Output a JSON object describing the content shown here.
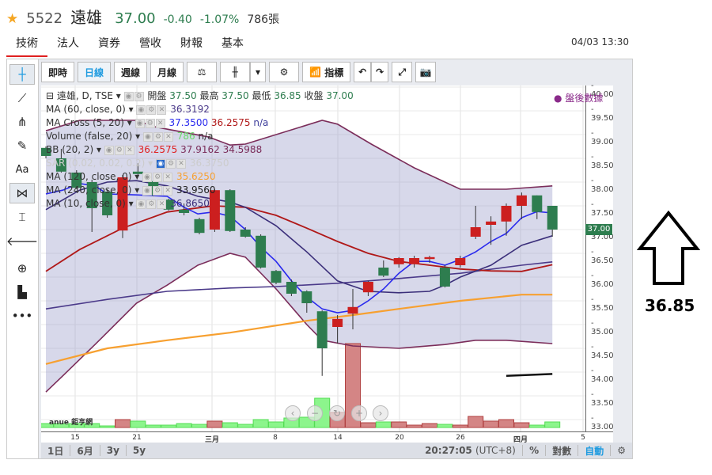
{
  "header": {
    "code": "5522",
    "name": "遠雄",
    "price": "37.00",
    "change": "-0.40",
    "change_pct": "-1.07%",
    "volume": "786張"
  },
  "tabs": [
    "技術",
    "法人",
    "資券",
    "營收",
    "財報",
    "基本"
  ],
  "datetime": "04/03 13:30",
  "toolbar": {
    "realtime": "即時",
    "daily": "日線",
    "weekly": "週線",
    "monthly": "月線",
    "indicators": "指標"
  },
  "legend": {
    "title": "遠雄, D, TSE",
    "open_label": "開盤",
    "open": "37.50",
    "high_label": "最高",
    "high": "37.50",
    "low_label": "最低",
    "low": "36.85",
    "close_label": "收盤",
    "close": "37.00",
    "ma60": "MA (60, close, 0)",
    "ma60_val": "36.3192",
    "macross": "MA Cross (5, 20)",
    "macross_v1": "37.3500",
    "macross_v2": "36.2575",
    "macross_v3": "n/a",
    "volume": "Volume (false, 20)",
    "volume_v1": "786",
    "volume_v2": "n/a",
    "bb": "BB (20, 2)",
    "bb_v1": "36.2575",
    "bb_v2": "37.9162",
    "bb_v3": "34.5988",
    "sar": "SAR (0.02, 0.02, 0.2)",
    "sar_val": "36.3750",
    "ma120": "MA (120, close, 0)",
    "ma120_val": "35.6250",
    "ma240": "MA (240, close, 0)",
    "ma240_val": "33.9560",
    "ma10": "MA (10, close, 0)",
    "ma10_val": "36.8650",
    "after_hours": "盤後數據"
  },
  "price_axis": [
    "40.00",
    "39.50",
    "39.00",
    "38.50",
    "38.00",
    "37.50",
    "37.00",
    "36.50",
    "36.00",
    "35.50",
    "35.00",
    "34.50",
    "34.00",
    "33.50",
    "33.00"
  ],
  "current_price_tag": "37.00",
  "x_axis": [
    "15",
    "21",
    "三月",
    "8",
    "14",
    "20",
    "26",
    "四月",
    "5"
  ],
  "logo": "anue 鉅亨網",
  "bottom": {
    "ranges": [
      "1日",
      "6月",
      "3y",
      "5y"
    ],
    "clock": "20:27:05",
    "tz": "(UTC+8)",
    "pct": "%",
    "log": "對數",
    "auto": "自動"
  },
  "annotation": {
    "value": "36.85"
  },
  "colors": {
    "up": "#cc1f1f",
    "down": "#2e7d4f",
    "ma5": "#2a2aee",
    "ma10": "#3b2f7a",
    "ma20": "#b01818",
    "ma60": "#4b3a8a",
    "ma120": "#f7a030",
    "bb": "#7b2d5a",
    "accent": "#1e9be0"
  },
  "chart_data": {
    "type": "candlestick",
    "ylim": [
      33,
      40
    ],
    "candles": [
      [
        38.72,
        38.75,
        38.5,
        38.55
      ],
      [
        38.5,
        38.7,
        38.2,
        38.22
      ],
      [
        38.2,
        38.25,
        37.85,
        37.88
      ],
      [
        38.0,
        38.05,
        36.95,
        37.45
      ],
      [
        37.8,
        37.85,
        37.25,
        37.3
      ],
      [
        36.98,
        38.15,
        36.82,
        38.1
      ],
      [
        38.22,
        38.4,
        38.15,
        38.17
      ],
      [
        38.02,
        38.05,
        37.7,
        37.72
      ],
      [
        37.63,
        37.65,
        37.4,
        37.42
      ],
      [
        37.42,
        37.55,
        37.3,
        37.35
      ],
      [
        37.22,
        37.25,
        36.9,
        36.93
      ],
      [
        37.0,
        37.85,
        36.95,
        37.83
      ],
      [
        37.83,
        37.85,
        36.95,
        36.97
      ],
      [
        37.0,
        37.05,
        36.83,
        36.85
      ],
      [
        36.87,
        36.9,
        36.18,
        36.2
      ],
      [
        36.13,
        36.15,
        35.85,
        35.88
      ],
      [
        35.9,
        35.95,
        35.6,
        35.65
      ],
      [
        35.7,
        35.72,
        35.25,
        35.45
      ],
      [
        35.28,
        35.3,
        33.92,
        34.5
      ],
      [
        34.95,
        35.2,
        34.6,
        35.12
      ],
      [
        35.23,
        35.75,
        34.9,
        35.37
      ],
      [
        35.68,
        35.92,
        35.6,
        35.9
      ],
      [
        36.2,
        36.35,
        36.0,
        36.03
      ],
      [
        36.27,
        36.42,
        36.2,
        36.4
      ],
      [
        36.27,
        36.45,
        36.2,
        36.4
      ],
      [
        36.38,
        36.45,
        36.3,
        36.42
      ],
      [
        36.2,
        36.25,
        35.78,
        35.8
      ],
      [
        36.25,
        36.45,
        36.2,
        36.4
      ],
      [
        36.85,
        37.5,
        36.8,
        37.05
      ],
      [
        37.1,
        37.28,
        36.68,
        37.17
      ],
      [
        37.17,
        37.55,
        36.87,
        37.5
      ],
      [
        37.5,
        37.78,
        37.22,
        37.72
      ],
      [
        37.72,
        37.72,
        37.22,
        37.37
      ],
      [
        37.5,
        37.5,
        36.85,
        37.0
      ]
    ],
    "volumes": [
      560,
      560,
      560,
      560,
      224,
      1120,
      900,
      336,
      336,
      560,
      448,
      900,
      672,
      448,
      1120,
      786,
      1344,
      1456,
      4144,
      2128,
      11872,
      672,
      786,
      786,
      336,
      560,
      448,
      336,
      1568,
      900,
      1120,
      672,
      336,
      786
    ],
    "series": {
      "bb_upper": [
        [
          0,
          39.08
        ],
        [
          2.2,
          39.3
        ],
        [
          5.9,
          39.3
        ],
        [
          7,
          39.17
        ],
        [
          10.6,
          38.95
        ],
        [
          12,
          38.78
        ],
        [
          13,
          38.8
        ],
        [
          18,
          39.3
        ],
        [
          19,
          39.22
        ],
        [
          21.2,
          38.8
        ],
        [
          24,
          38.3
        ],
        [
          27,
          37.85
        ],
        [
          30,
          37.85
        ],
        [
          33,
          37.92
        ]
      ],
      "bb_lower": [
        [
          0,
          33.58
        ],
        [
          1.1,
          33.92
        ],
        [
          3.2,
          34.58
        ],
        [
          5.9,
          35.45
        ],
        [
          7.9,
          35.83
        ],
        [
          9.9,
          36.25
        ],
        [
          12,
          36.5
        ],
        [
          13,
          36.42
        ],
        [
          15,
          35.75
        ],
        [
          17,
          35.0
        ],
        [
          18,
          34.67
        ],
        [
          20,
          34.55
        ],
        [
          23,
          34.5
        ],
        [
          26,
          34.58
        ],
        [
          28,
          34.67
        ],
        [
          30,
          34.67
        ],
        [
          33,
          34.6
        ]
      ],
      "ma20": [
        [
          0,
          36.12
        ],
        [
          2.2,
          36.58
        ],
        [
          5,
          37.03
        ],
        [
          7.9,
          37.37
        ],
        [
          10.9,
          37.5
        ],
        [
          13,
          37.47
        ],
        [
          15,
          37.3
        ],
        [
          17,
          37.03
        ],
        [
          19,
          36.75
        ],
        [
          21,
          36.5
        ],
        [
          23,
          36.33
        ],
        [
          25,
          36.25
        ],
        [
          27,
          36.17
        ],
        [
          29,
          36.13
        ],
        [
          31,
          36.12
        ],
        [
          33,
          36.26
        ]
      ],
      "ma5": [
        [
          0,
          37.75
        ],
        [
          1.1,
          37.83
        ],
        [
          2.2,
          37.97
        ],
        [
          3.2,
          37.92
        ],
        [
          4,
          37.75
        ],
        [
          5.9,
          37.73
        ],
        [
          7.9,
          37.7
        ],
        [
          9,
          37.47
        ],
        [
          9.9,
          37.33
        ],
        [
          10.9,
          37.37
        ],
        [
          12,
          37.28
        ],
        [
          13,
          37.0
        ],
        [
          14,
          36.63
        ],
        [
          15,
          36.33
        ],
        [
          16,
          35.92
        ],
        [
          17,
          35.58
        ],
        [
          18,
          35.33
        ],
        [
          19,
          35.25
        ],
        [
          20,
          35.3
        ],
        [
          21,
          35.5
        ],
        [
          22,
          35.75
        ],
        [
          23,
          36.08
        ],
        [
          24,
          36.33
        ],
        [
          25,
          36.33
        ],
        [
          26,
          36.25
        ],
        [
          27,
          36.37
        ],
        [
          28,
          36.53
        ],
        [
          29,
          36.75
        ],
        [
          30,
          36.92
        ],
        [
          31,
          37.25
        ],
        [
          32,
          37.38
        ],
        [
          33,
          37.35
        ]
      ],
      "ma10": [
        [
          0,
          37.42
        ],
        [
          2.2,
          37.83
        ],
        [
          4,
          38.0
        ],
        [
          5.9,
          38.03
        ],
        [
          7.9,
          37.92
        ],
        [
          9.9,
          37.7
        ],
        [
          12,
          37.58
        ],
        [
          13,
          37.47
        ],
        [
          15,
          37.08
        ],
        [
          17,
          36.53
        ],
        [
          19,
          35.92
        ],
        [
          21,
          35.7
        ],
        [
          23,
          35.67
        ],
        [
          25,
          35.7
        ],
        [
          26,
          35.83
        ],
        [
          27,
          36.0
        ],
        [
          29,
          36.25
        ],
        [
          31,
          36.67
        ],
        [
          33,
          36.87
        ]
      ],
      "ma60": [
        [
          0,
          35.33
        ],
        [
          4,
          35.53
        ],
        [
          7.9,
          35.7
        ],
        [
          12,
          35.77
        ],
        [
          15,
          35.8
        ],
        [
          19,
          35.87
        ],
        [
          23,
          35.97
        ],
        [
          27,
          36.08
        ],
        [
          31,
          36.25
        ],
        [
          33,
          36.32
        ]
      ],
      "ma120": [
        [
          0,
          34.17
        ],
        [
          4,
          34.5
        ],
        [
          7.9,
          34.67
        ],
        [
          12,
          34.83
        ],
        [
          17,
          35.08
        ],
        [
          20,
          35.2
        ],
        [
          23,
          35.33
        ],
        [
          27,
          35.5
        ],
        [
          31,
          35.63
        ],
        [
          33,
          35.63
        ]
      ],
      "ma240": [
        [
          30,
          33.92
        ],
        [
          33,
          33.96
        ]
      ]
    }
  }
}
